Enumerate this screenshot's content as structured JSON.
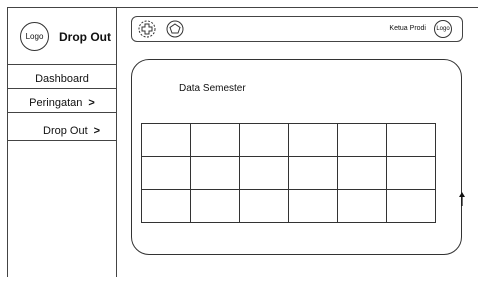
{
  "sidebar": {
    "logo_text": "Logo",
    "brand": "Drop Out",
    "items": [
      {
        "label": "Dashboard",
        "arrow": ""
      },
      {
        "label": "Peringatan",
        "arrow": ">"
      },
      {
        "label": "Drop Out",
        "arrow": ">"
      }
    ]
  },
  "topbar": {
    "icons": [
      "add-circle-icon",
      "pentagon-icon"
    ],
    "user_label": "Ketua Prodi",
    "avatar_text": "Logo"
  },
  "main": {
    "panel_title": "Data Semester",
    "table": {
      "headers": [
        "",
        "",
        "",
        "",
        "",
        ""
      ],
      "rows": [
        [
          "",
          "",
          "",
          "",
          "",
          ""
        ],
        [
          "",
          "",
          "",
          "",
          "",
          ""
        ]
      ]
    }
  }
}
